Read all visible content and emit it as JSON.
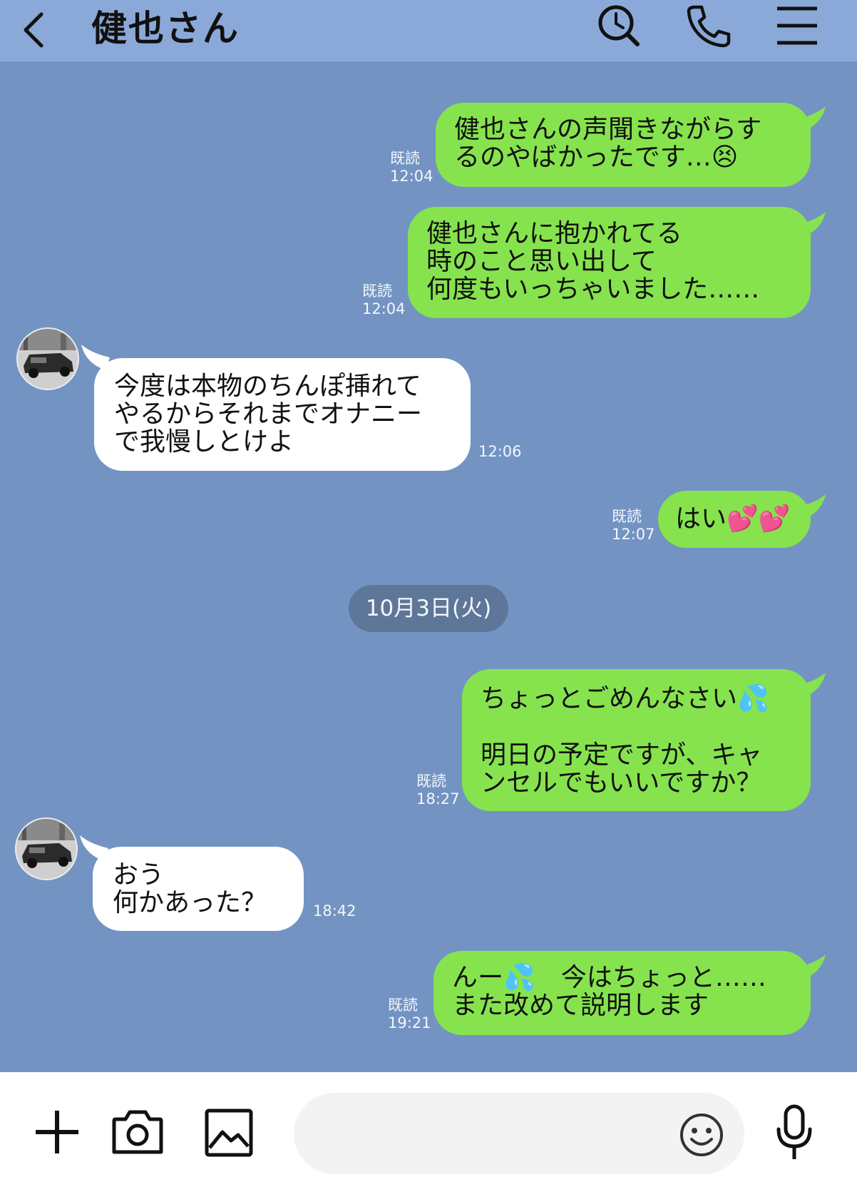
{
  "header": {
    "title": "健也さん",
    "icons": [
      "back-chevron-icon",
      "search-history-icon",
      "phone-icon",
      "menu-icon"
    ]
  },
  "colors": {
    "header_bg": "#8aa9d8",
    "chat_bg": "#7394c2",
    "outgoing_bubble": "#86e34e",
    "incoming_bubble": "#ffffff",
    "date_pill": "#5e7799"
  },
  "messages": [
    {
      "dir": "out",
      "text": "健也さんの声聞きながらす\nるのやばかったです…",
      "emoji": "😣",
      "read": "既読",
      "time": "12:04"
    },
    {
      "dir": "out",
      "text": "健也さんに抱かれてる\n時のこと思い出して\n何度もいっちゃいました……",
      "read": "既読",
      "time": "12:04"
    },
    {
      "dir": "in",
      "text": "今度は本物のちんぽ挿れて\nやるからそれまでオナニー\nで我慢しとけよ",
      "time": "12:06"
    },
    {
      "dir": "out",
      "text": "はい",
      "emoji": "💕💕",
      "read": "既読",
      "time": "12:07"
    },
    {
      "dir": "out",
      "text_line1": "ちょっとごめんなさい",
      "emoji": "💦",
      "text_rest": "明日の予定ですが、キャ\nンセルでもいいですか？",
      "read": "既読",
      "time": "18:27"
    },
    {
      "dir": "in",
      "text": "おう\n何かあった？",
      "time": "18:42"
    },
    {
      "dir": "out",
      "text_a": "んー",
      "emoji": "💦",
      "text_b": "　今はちょっと……",
      "text_rest": "また改めて説明します",
      "read": "既読",
      "time": "19:21"
    }
  ],
  "date_separator": "10月3日(火)",
  "footer": {
    "icons": [
      "plus-icon",
      "camera-icon",
      "image-icon",
      "emoji-icon",
      "microphone-icon"
    ],
    "input_placeholder": ""
  }
}
